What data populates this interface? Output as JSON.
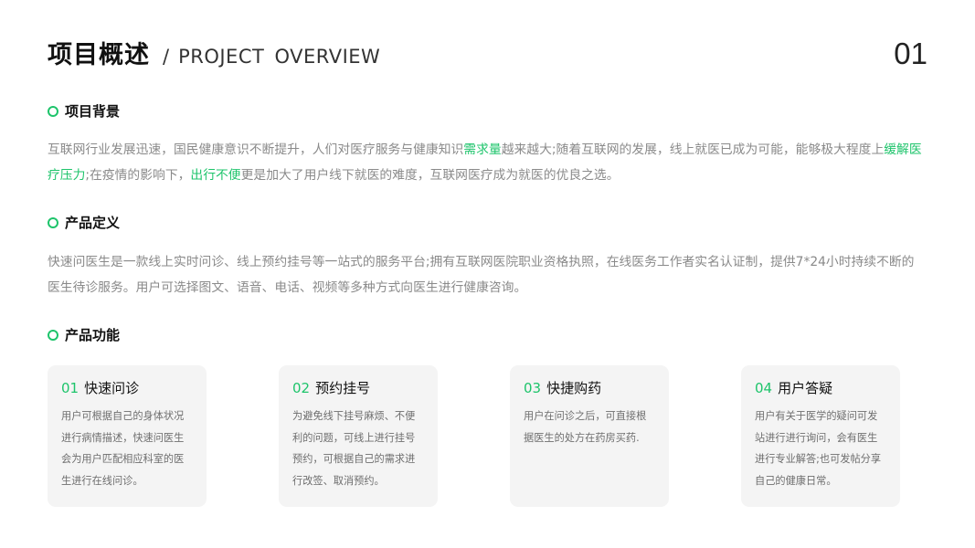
{
  "header": {
    "title_cn": "项目概述",
    "separator": "/",
    "title_en": "PROJECT OVERVIEW",
    "page_number": "01"
  },
  "sections": [
    {
      "title": "项目背景",
      "text_parts": [
        {
          "text": "互联网行业发展迅速，国民健康意识不断提升，人们对医疗服务与健康知识",
          "highlight": false
        },
        {
          "text": "需求量",
          "highlight": true
        },
        {
          "text": "越来越大;随着互联网的发展，线上就医已成为可能，能够极大程度上",
          "highlight": false
        },
        {
          "text": "缓解医疗压力",
          "highlight": true
        },
        {
          "text": ";在疫情的影响下，",
          "highlight": false
        },
        {
          "text": "出行不便",
          "highlight": true
        },
        {
          "text": "更是加大了用户线下就医的难度，互联网医疗成为就医的优良之选。",
          "highlight": false
        }
      ]
    },
    {
      "title": "产品定义",
      "text_parts": [
        {
          "text": "快速问医生是一款线上实时问诊、线上预约挂号等一站式的服务平台;拥有互联网医院职业资格执照，在线医务工作者实名认证制，提供7*24小时持续不断的医生待诊服务。用户可选择图文、语音、电话、视频等多种方式向医生进行健康咨询。",
          "highlight": false
        }
      ]
    },
    {
      "title": "产品功能"
    }
  ],
  "features": [
    {
      "num": "01",
      "title": "快速问诊",
      "desc": "用户可根据自己的身体状况进行病情描述，快速问医生会为用户匹配相应科室的医生进行在线问诊。"
    },
    {
      "num": "02",
      "title": "预约挂号",
      "desc": "为避免线下挂号麻烦、不便利的问题，可线上进行挂号预约，可根据自己的需求进行改签、取消预约。"
    },
    {
      "num": "03",
      "title": "快捷购药",
      "desc": "用户在问诊之后，可直接根据医生的处方在药房买药."
    },
    {
      "num": "04",
      "title": "用户答疑",
      "desc": "用户有关于医学的疑问可发站进行进行询问，会有医生进行专业解答;也可发帖分享自己的健康日常。"
    }
  ],
  "colors": {
    "accent": "#1ec46b",
    "body_text": "#8a8a8a",
    "card_bg": "#f4f4f4"
  }
}
